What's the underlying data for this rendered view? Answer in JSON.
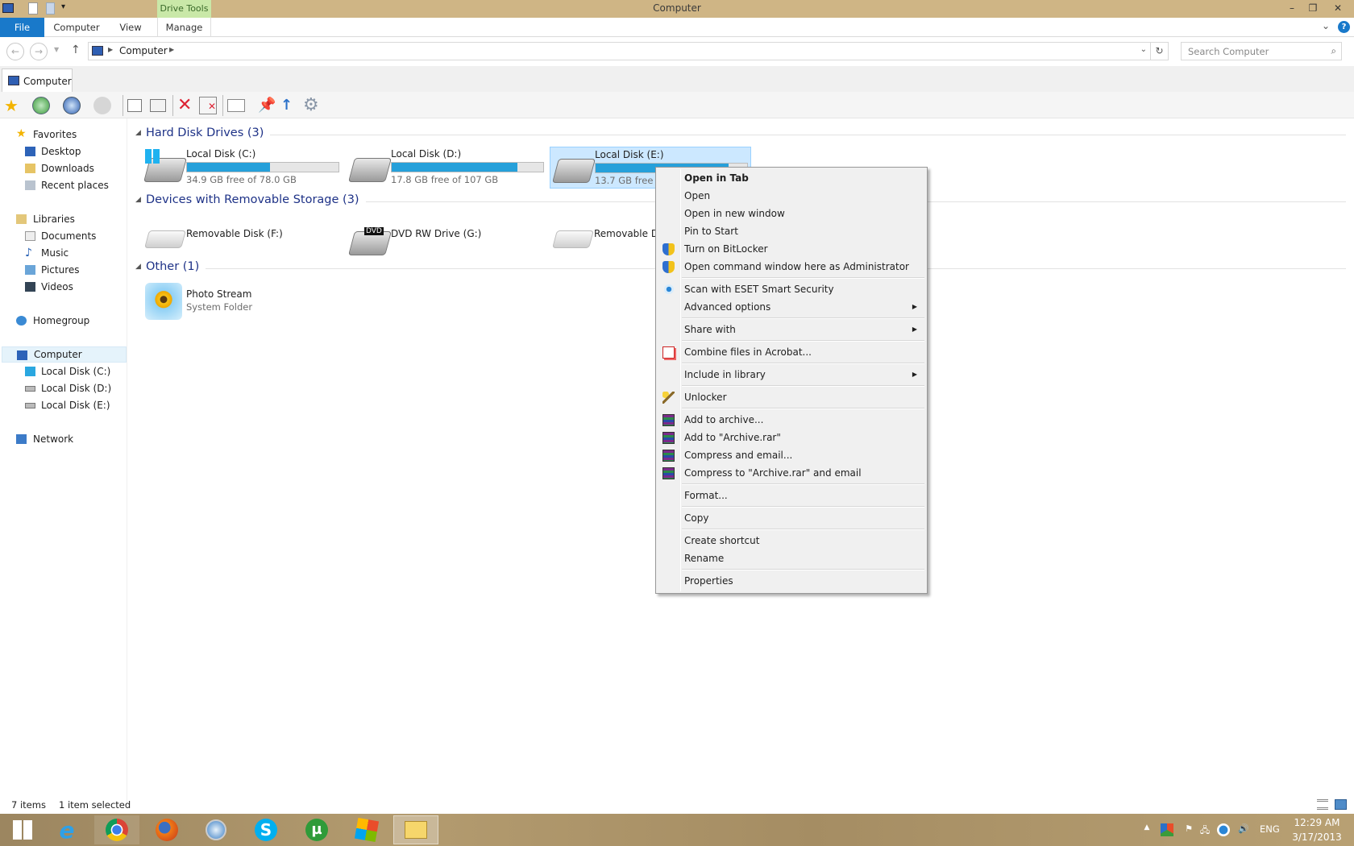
{
  "window": {
    "title": "Computer",
    "context_tab_group": "Drive Tools"
  },
  "ribbon": {
    "tabs": [
      {
        "label": "File"
      },
      {
        "label": "Computer"
      },
      {
        "label": "View"
      },
      {
        "label": "Manage"
      }
    ]
  },
  "address": {
    "breadcrumb": [
      "Computer"
    ],
    "search_placeholder": "Search Computer"
  },
  "tabs": [
    {
      "label": "Computer"
    }
  ],
  "sidebar": {
    "items": [
      {
        "label": "Favorites",
        "icon": "star-icon",
        "level": 0
      },
      {
        "label": "Desktop",
        "icon": "desktop-icon",
        "level": 1
      },
      {
        "label": "Downloads",
        "icon": "downloads-icon",
        "level": 1
      },
      {
        "label": "Recent places",
        "icon": "recent-places-icon",
        "level": 1
      },
      {
        "label": "Libraries",
        "icon": "libraries-icon",
        "level": 0
      },
      {
        "label": "Documents",
        "icon": "documents-icon",
        "level": 1
      },
      {
        "label": "Music",
        "icon": "music-icon",
        "level": 1
      },
      {
        "label": "Pictures",
        "icon": "pictures-icon",
        "level": 1
      },
      {
        "label": "Videos",
        "icon": "videos-icon",
        "level": 1
      },
      {
        "label": "Homegroup",
        "icon": "homegroup-icon",
        "level": 0
      },
      {
        "label": "Computer",
        "icon": "computer-icon",
        "level": 0,
        "selected": true
      },
      {
        "label": "Local Disk (C:)",
        "icon": "drive-icon",
        "level": 1
      },
      {
        "label": "Local Disk (D:)",
        "icon": "drive-icon",
        "level": 1
      },
      {
        "label": "Local Disk (E:)",
        "icon": "drive-icon",
        "level": 1
      },
      {
        "label": "Network",
        "icon": "network-icon",
        "level": 0
      }
    ]
  },
  "groups": [
    {
      "title": "Hard Disk Drives (3)",
      "items": [
        {
          "name": "Local Disk (C:)",
          "free": "34.9 GB free of 78.0 GB",
          "used_pct": 55
        },
        {
          "name": "Local Disk (D:)",
          "free": "17.8 GB free of 107 GB",
          "used_pct": 83
        },
        {
          "name": "Local Disk (E:)",
          "free": "13.7 GB free of",
          "used_pct": 88,
          "selected": true
        }
      ]
    },
    {
      "title": "Devices with Removable Storage (3)",
      "items": [
        {
          "name": "Removable Disk (F:)"
        },
        {
          "name": "DVD RW Drive (G:)",
          "badge": "DVD"
        },
        {
          "name": "Removable Di"
        }
      ]
    },
    {
      "title": "Other (1)",
      "items": [
        {
          "name": "Photo Stream",
          "sub": "System Folder"
        }
      ]
    }
  ],
  "context_menu": {
    "items": [
      {
        "label": "Open in Tab",
        "bold": true
      },
      {
        "label": "Open"
      },
      {
        "label": "Open in new window"
      },
      {
        "label": "Pin to Start"
      },
      {
        "label": "Turn on BitLocker",
        "icon": "uac-shield-icon"
      },
      {
        "label": "Open command window here as Administrator",
        "icon": "uac-shield-icon"
      },
      {
        "sep": true
      },
      {
        "label": "Scan with ESET Smart Security",
        "icon": "eset-icon"
      },
      {
        "label": "Advanced options",
        "submenu": true
      },
      {
        "sep": true
      },
      {
        "label": "Share with",
        "submenu": true
      },
      {
        "sep": true
      },
      {
        "label": "Combine files in Acrobat...",
        "icon": "acrobat-icon"
      },
      {
        "sep": true
      },
      {
        "label": "Include in library",
        "submenu": true
      },
      {
        "sep": true
      },
      {
        "label": "Unlocker",
        "icon": "unlocker-wand-icon"
      },
      {
        "sep": true
      },
      {
        "label": "Add to archive...",
        "icon": "winrar-icon"
      },
      {
        "label": "Add to \"Archive.rar\"",
        "icon": "winrar-icon"
      },
      {
        "label": "Compress and email...",
        "icon": "winrar-icon"
      },
      {
        "label": "Compress to \"Archive.rar\" and email",
        "icon": "winrar-icon"
      },
      {
        "sep": true
      },
      {
        "label": "Format..."
      },
      {
        "sep": true
      },
      {
        "label": "Copy"
      },
      {
        "sep": true
      },
      {
        "label": "Create shortcut"
      },
      {
        "label": "Rename"
      },
      {
        "sep": true
      },
      {
        "label": "Properties"
      }
    ]
  },
  "status": {
    "count": "7 items",
    "selection": "1 item selected"
  },
  "taskbar": {
    "apps": [
      "start",
      "internet-explorer",
      "chrome",
      "firefox",
      "safari",
      "skype",
      "utorrent",
      "windows-live",
      "file-explorer"
    ],
    "active": "file-explorer",
    "language": "ENG",
    "time": "12:29 AM",
    "date": "3/17/2013"
  },
  "colors": {
    "accent": "#1979ca",
    "selection": "#cce8ff",
    "bar_fill": "#26a0da",
    "titlebar": "#cfb585",
    "drive_tools": "#c9e8a8"
  }
}
